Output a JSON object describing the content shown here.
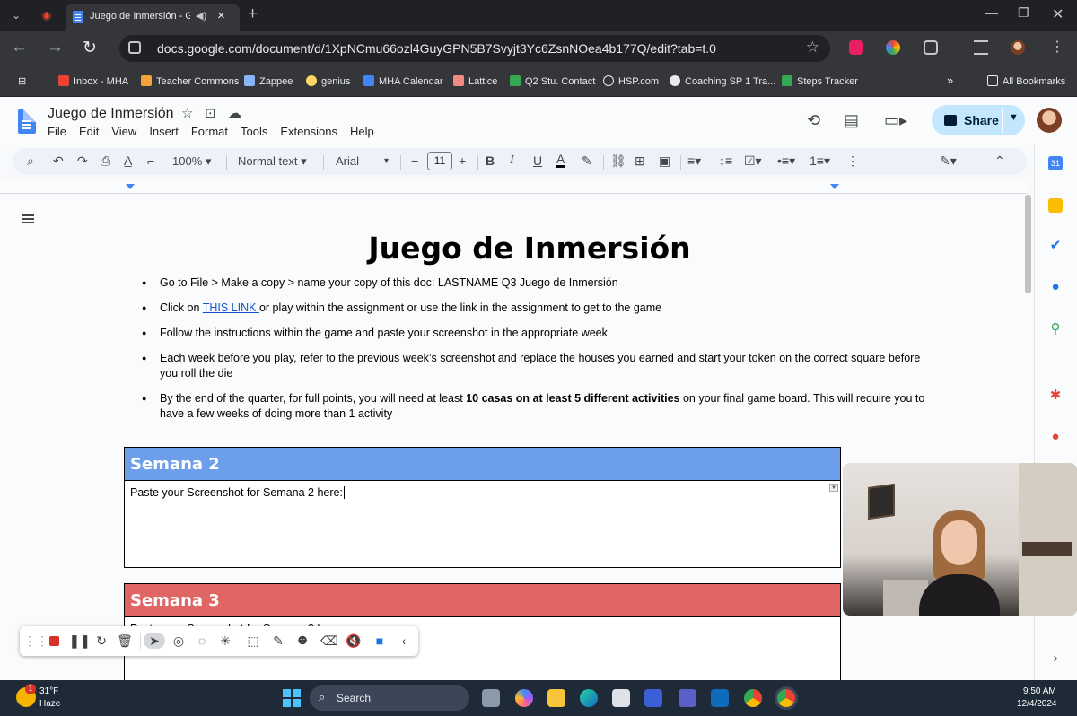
{
  "browser": {
    "tab_title": "Juego de Inmersión - Go",
    "url": "docs.google.com/document/d/1XpNCmu66ozl4GuyGPN5B7Svyjt3Yc6ZsnNOea4b177Q/edit?tab=t.0",
    "bookmarks": [
      "Inbox - MHA",
      "Teacher Commons",
      "Zappee",
      "genius",
      "MHA Calendar",
      "Lattice",
      "Q2 Stu. Contact",
      "HSP.com",
      "Coaching SP 1 Tra...",
      "Steps Tracker"
    ],
    "all_bookmarks": "All Bookmarks"
  },
  "docs": {
    "title": "Juego de Inmersión",
    "menu": [
      "File",
      "Edit",
      "View",
      "Insert",
      "Format",
      "Tools",
      "Extensions",
      "Help"
    ],
    "share_label": "Share",
    "toolbar": {
      "zoom": "100%",
      "style": "Normal text",
      "font": "Arial",
      "font_size": "11"
    }
  },
  "document": {
    "heading": "Juego de Inmersión",
    "bullets": {
      "b1": "Go to File > Make a copy > name your copy of this doc: LASTNAME Q3 Juego de Inmersión",
      "b2_pre": "Click on ",
      "b2_link": "THIS LINK ",
      "b2_post": "or play within the assignment or use the link in the assignment to get to the game",
      "b3": "Follow the instructions within the game and paste your screenshot in the appropriate week",
      "b4": "Each week before you play, refer to the previous week’s screenshot and replace the houses you earned and start your token on the correct square before you roll the die",
      "b5_pre": "By the end of the quarter, for full points, you will need at least ",
      "b5_bold": "10 casas on at least 5 different activities",
      "b5_post": " on your final game board. This will require you to have a few weeks of doing more than 1 activity"
    },
    "weeks": [
      {
        "title": "Semana 2",
        "prompt": "Paste your Screenshot for Semana 2 here:",
        "color": "#6d9eeb"
      },
      {
        "title": "Semana 3",
        "prompt": "Paste your Screenshot for Semana 3 here:",
        "color": "#e06666"
      }
    ]
  },
  "taskbar": {
    "temperature": "31°F",
    "weather": "Haze",
    "weather_badge": "1",
    "search_label": "Search",
    "time": "9:50 AM",
    "date": "12/4/2024"
  }
}
